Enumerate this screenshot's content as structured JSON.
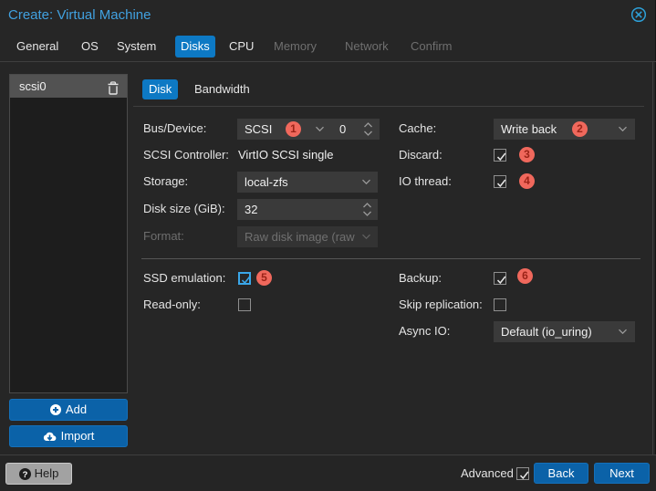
{
  "dialog": {
    "title": "Create: Virtual Machine"
  },
  "wizard_tabs": [
    {
      "label": "General",
      "state": "enabled"
    },
    {
      "label": "OS",
      "state": "enabled"
    },
    {
      "label": "System",
      "state": "enabled"
    },
    {
      "label": "Disks",
      "state": "active"
    },
    {
      "label": "CPU",
      "state": "enabled"
    },
    {
      "label": "Memory",
      "state": "disabled"
    },
    {
      "label": "Network",
      "state": "disabled"
    },
    {
      "label": "Confirm",
      "state": "disabled"
    }
  ],
  "sidebar": {
    "items": [
      {
        "label": "scsi0",
        "selected": true
      }
    ],
    "add_label": "Add",
    "import_label": "Import"
  },
  "panel_tabs": [
    {
      "label": "Disk",
      "active": true
    },
    {
      "label": "Bandwidth",
      "active": false
    }
  ],
  "form": {
    "bus_device": {
      "label": "Bus/Device:",
      "value": "SCSI",
      "port": "0",
      "badge": "1"
    },
    "scsi_controller": {
      "label": "SCSI Controller:",
      "value": "VirtIO SCSI single"
    },
    "storage": {
      "label": "Storage:",
      "value": "local-zfs"
    },
    "disk_size": {
      "label": "Disk size (GiB):",
      "value": "32"
    },
    "format": {
      "label": "Format:",
      "value": "Raw disk image (raw",
      "disabled": true
    },
    "cache": {
      "label": "Cache:",
      "value": "Write back",
      "badge": "2"
    },
    "discard": {
      "label": "Discard:",
      "checked": true,
      "badge": "3"
    },
    "io_thread": {
      "label": "IO thread:",
      "checked": true,
      "badge": "4"
    },
    "ssd_emulation": {
      "label": "SSD emulation:",
      "checked": true,
      "focused": true,
      "badge": "5"
    },
    "read_only": {
      "label": "Read-only:",
      "checked": false
    },
    "backup": {
      "label": "Backup:",
      "checked": true,
      "badge": "6"
    },
    "skip_replication": {
      "label": "Skip replication:",
      "checked": false
    },
    "async_io": {
      "label": "Async IO:",
      "value": "Default (io_uring)"
    }
  },
  "footer": {
    "help_label": "Help",
    "advanced_label": "Advanced",
    "advanced_checked": true,
    "back_label": "Back",
    "next_label": "Next"
  },
  "colors": {
    "accent_blue": "#0d79c4",
    "button_blue": "#0b62a8",
    "title_blue": "#41a1e0",
    "badge_red": "#f0685c",
    "background": "#262626"
  }
}
